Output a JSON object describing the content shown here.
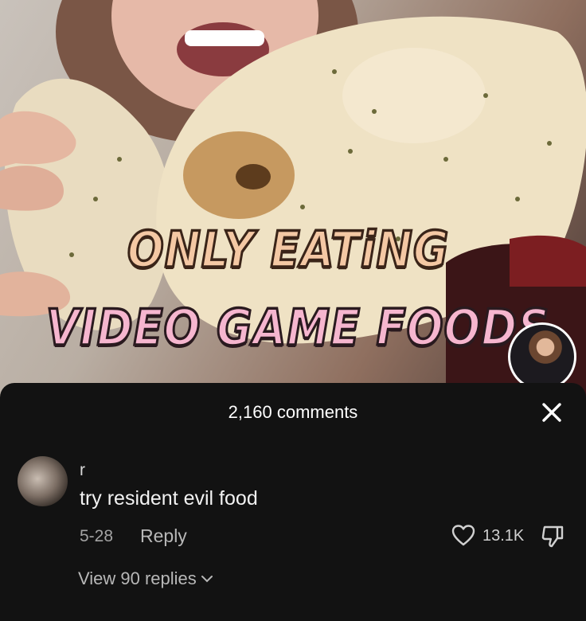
{
  "video": {
    "overlay_line1": "ONLY  EATiNG",
    "overlay_line2": "VIDEO GAME FOODS"
  },
  "comments_sheet": {
    "title": "2,160 comments",
    "close_icon": "close-icon",
    "comment": {
      "username": "r",
      "text": "try resident evil food",
      "date": "5-28",
      "reply_label": "Reply",
      "like_count": "13.1K",
      "view_replies_label": "View 90 replies"
    }
  },
  "colors": {
    "sheet_background": "#121212",
    "overlay_line1": "#f4c8a4",
    "overlay_line2": "#f6b6cf"
  }
}
